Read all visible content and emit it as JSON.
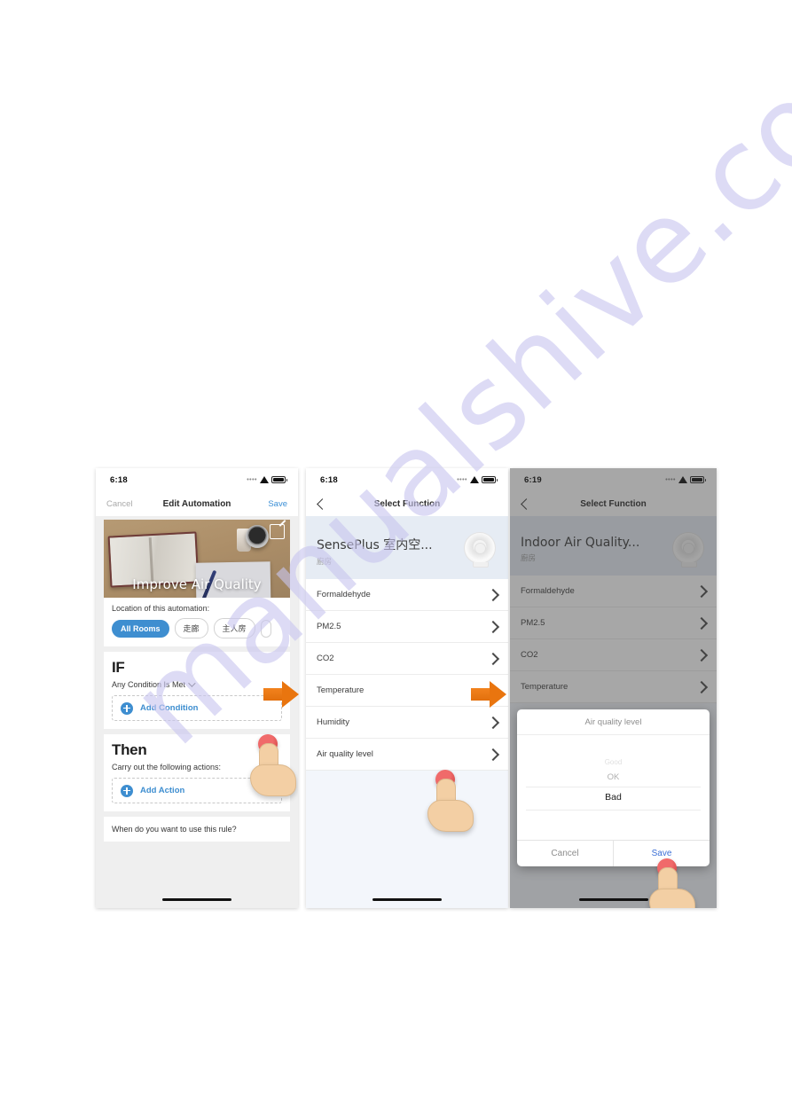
{
  "watermark": {
    "text": "manualshive.com",
    "color": "#c9c6ef"
  },
  "accent": {
    "blue": "#3e8ed0",
    "link_blue": "#3b8fd6",
    "orange": "#e9750f",
    "tap_red": "#c73535"
  },
  "arrows": [
    {
      "name": "flow-arrow-1",
      "glyph": "arrow-right-icon"
    },
    {
      "name": "flow-arrow-2",
      "glyph": "arrow-right-icon"
    }
  ],
  "screens": [
    {
      "id": "edit-automation",
      "status_bar": {
        "time": "6:18",
        "signal": "signal-dots-icon",
        "wifi": "wifi-icon",
        "battery": "battery-icon"
      },
      "nav": {
        "left": "Cancel",
        "title": "Edit Automation",
        "right": "Save"
      },
      "hero": {
        "title": "Improve Air Quality",
        "edit_icon": "edit-pencil-icon"
      },
      "location": {
        "label": "Location of this automation:",
        "chips": [
          {
            "label": "All Rooms",
            "selected": true
          },
          {
            "label": "走廊",
            "selected": false
          },
          {
            "label": "主人房",
            "selected": false
          }
        ]
      },
      "if_section": {
        "heading": "IF",
        "condition_mode": "Any Condition Is Met",
        "add_label": "Add Condition"
      },
      "then_section": {
        "heading": "Then",
        "subtitle": "Carry out the following actions:",
        "add_label": "Add Action"
      },
      "rule_card": {
        "text": "When do you want to use this rule?"
      }
    },
    {
      "id": "select-function-light",
      "status_bar": {
        "time": "6:18",
        "signal": "signal-dots-icon",
        "wifi": "wifi-icon",
        "battery": "battery-icon"
      },
      "nav": {
        "left": "back-chevron-icon",
        "title": "Select Function"
      },
      "device": {
        "name": "SensePlus 室内空...",
        "room": "廚房",
        "icon": "air-sensor-icon"
      },
      "functions": [
        {
          "label": "Formaldehyde",
          "arrow": "chevron-right-icon"
        },
        {
          "label": "PM2.5",
          "arrow": "chevron-right-icon"
        },
        {
          "label": "CO2",
          "arrow": "chevron-right-icon"
        },
        {
          "label": "Temperature",
          "arrow": "chevron-right-icon"
        },
        {
          "label": "Humidity",
          "arrow": "chevron-right-icon"
        },
        {
          "label": "Air quality level",
          "arrow": "chevron-right-icon"
        }
      ]
    },
    {
      "id": "select-function-picker",
      "status_bar": {
        "time": "6:19",
        "signal": "signal-dots-icon",
        "wifi": "wifi-icon",
        "battery": "battery-icon"
      },
      "nav": {
        "left": "back-chevron-icon",
        "title": "Select Function"
      },
      "device": {
        "name": "Indoor Air Quality...",
        "room": "廚房",
        "icon": "air-sensor-icon"
      },
      "functions": [
        {
          "label": "Formaldehyde",
          "arrow": "chevron-right-icon"
        },
        {
          "label": "PM2.5",
          "arrow": "chevron-right-icon"
        },
        {
          "label": "CO2",
          "arrow": "chevron-right-icon"
        },
        {
          "label": "Temperature",
          "arrow": "chevron-right-icon"
        }
      ],
      "picker": {
        "title": "Air quality level",
        "options_above": "Good",
        "option_dim": "OK",
        "option_selected": "Bad",
        "cancel": "Cancel",
        "save": "Save"
      }
    }
  ]
}
